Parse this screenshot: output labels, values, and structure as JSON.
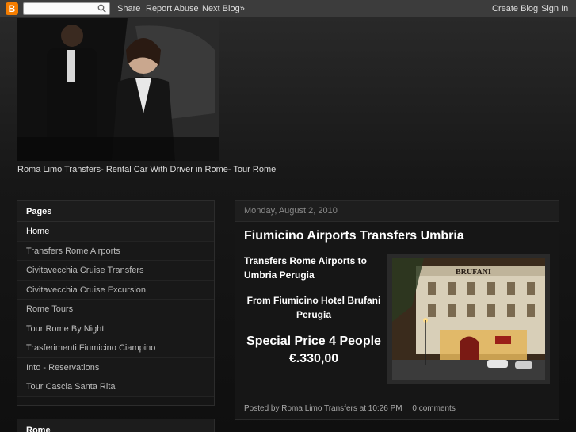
{
  "navbar": {
    "logo_letter": "B",
    "search_placeholder": "",
    "share": "Share",
    "report_abuse": "Report Abuse",
    "next_blog": "Next Blog»",
    "create_blog": "Create Blog",
    "sign_in": "Sign In"
  },
  "header": {
    "description": "Roma Limo Transfers- Rental Car With Driver in Rome- Tour Rome"
  },
  "sidebar": {
    "pages_title": "Pages",
    "pages": [
      {
        "label": "Home"
      },
      {
        "label": "Transfers Rome Airports"
      },
      {
        "label": "Civitavecchia Cruise Transfers"
      },
      {
        "label": "Civitavecchia Cruise Excursion"
      },
      {
        "label": "Rome Tours"
      },
      {
        "label": "Tour Rome By Night"
      },
      {
        "label": "Trasferimenti Fiumicino Ciampino"
      },
      {
        "label": "Into - Reservations"
      },
      {
        "label": "Tour Cascia Santa Rita"
      }
    ],
    "second_title": "Rome"
  },
  "post": {
    "date": "Monday, August 2, 2010",
    "title": "Fiumicino Airports Transfers Umbria",
    "line1": "Transfers Rome Airports to Umbria Perugia",
    "line2": "From Fiumicino Hotel Brufani Perugia",
    "line3": "Special Price 4 People €.330,00",
    "photo_sign": "BRUFANI",
    "posted_by": "Posted by",
    "author": "Roma Limo Transfers",
    "at": "at",
    "time": "10:26 PM",
    "comments": "0 comments"
  },
  "colors": {
    "navbar": "#3c3c3c",
    "blogger_orange": "#f57d00",
    "panel": "#151515"
  }
}
